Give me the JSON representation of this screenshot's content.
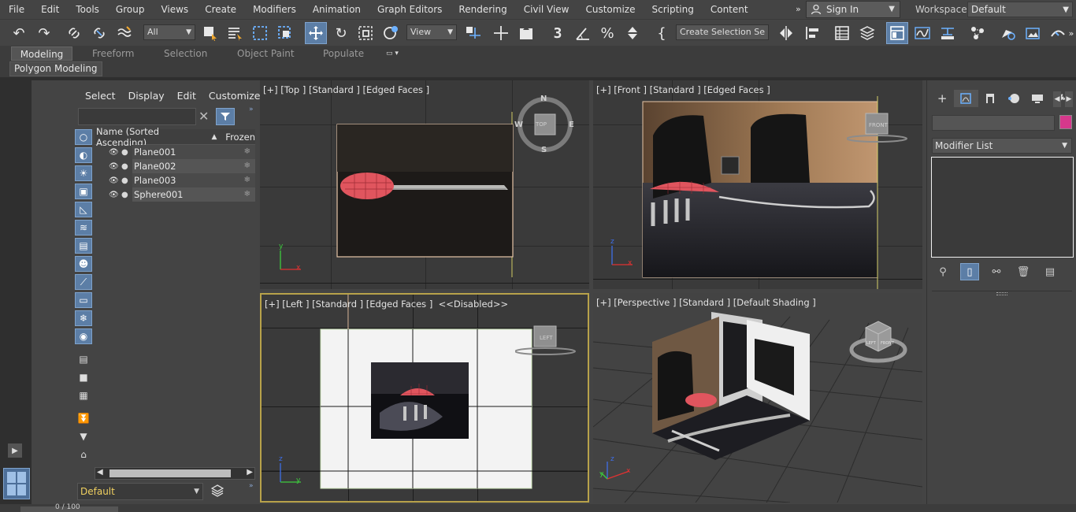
{
  "menubar": {
    "items": [
      "File",
      "Edit",
      "Tools",
      "Group",
      "Views",
      "Create",
      "Modifiers",
      "Animation",
      "Graph Editors",
      "Rendering",
      "Civil View",
      "Customize",
      "Scripting",
      "Content"
    ],
    "sign_in": "Sign In",
    "workspaces_label": "Workspaces:",
    "workspace_value": "Default"
  },
  "toolbar": {
    "selection_filter": "All",
    "ref_coord": "View",
    "named_selection": "Create Selection Se",
    "snap_number": "3",
    "icons": [
      "undo-icon",
      "redo-icon",
      "link-icon",
      "unlink-icon",
      "bind-space-warp-icon",
      "select-object-icon",
      "select-by-name-icon",
      "rectangular-selection-region-icon",
      "window-crossing-icon",
      "select-and-move-icon",
      "select-and-rotate-icon",
      "select-and-scale-icon",
      "select-and-place-icon",
      "use-pivot-center-icon",
      "select-and-manipulate-icon",
      "keyboard-shortcut-override-icon",
      "snaps-toggle-icon",
      "angle-snap-icon",
      "percent-snap-icon",
      "spinner-snap-icon",
      "edit-named-selection-icon",
      "mirror-icon",
      "align-icon",
      "scene-explorer-toggle-icon",
      "layer-explorer-icon",
      "toggle-ribbon-icon",
      "curve-editor-icon",
      "schematic-view-icon",
      "material-editor-icon",
      "render-setup-icon",
      "rendered-frame-window-icon",
      "render-production-icon"
    ]
  },
  "ribbon": {
    "tabs": [
      "Modeling",
      "Freeform",
      "Selection",
      "Object Paint",
      "Populate"
    ],
    "active_tab": "Modeling",
    "sub_tab": "Polygon Modeling"
  },
  "explorer": {
    "menu": [
      "Select",
      "Display",
      "Edit",
      "Customize"
    ],
    "col_name": "Name (Sorted Ascending)",
    "col_sort": "▲",
    "col_frozen": "Frozen",
    "rows": [
      {
        "name": "Plane001"
      },
      {
        "name": "Plane002"
      },
      {
        "name": "Plane003"
      },
      {
        "name": "Sphere001"
      }
    ],
    "layer": "Default",
    "side_icons": [
      "display-none-icon",
      "geometry-filter-icon",
      "shapes-filter-icon",
      "lights-filter-icon",
      "cameras-filter-icon",
      "helpers-filter-icon",
      "space-warps-filter-icon",
      "groups-filter-icon",
      "object-xrefs-filter-icon",
      "bones-filter-icon",
      "containers-filter-icon",
      "frozen-filter-icon",
      "hidden-filter-icon",
      "display-all-icon",
      "display-invert-icon",
      "select-all-icon",
      "select-none-icon",
      "select-invert-icon",
      "find-filter-icon"
    ]
  },
  "viewports": {
    "top": {
      "label": "[+] [Top ] [Standard ] [Edged Faces ]",
      "cube": "TOP",
      "compass": {
        "n": "N",
        "s": "S",
        "e": "E",
        "w": "W"
      }
    },
    "front": {
      "label": "[+] [Front ] [Standard ] [Edged Faces ]",
      "cube": "FRONT"
    },
    "left": {
      "label": "[+] [Left ] [Standard ] [Edged Faces ]  <<Disabled>>",
      "cube": "LEFT"
    },
    "perspective": {
      "label": "[+] [Perspective ] [Standard ] [Default Shading ]",
      "cube_front": "FRONT",
      "cube_left": "LEFT"
    },
    "axis": {
      "x": "x",
      "y": "y",
      "z": "z"
    }
  },
  "command_panel": {
    "tabs": [
      "create-icon",
      "modify-icon",
      "hierarchy-icon",
      "motion-icon",
      "display-icon",
      "utilities-icon"
    ],
    "modifier_list": "Modifier List",
    "object_color": "#d6388c",
    "stack_buttons": [
      "pin-stack-icon",
      "show-end-result-icon",
      "make-unique-icon",
      "remove-modifier-icon",
      "configure-modifier-sets-icon"
    ]
  },
  "bottom": {
    "time_slider": "0 / 100"
  }
}
